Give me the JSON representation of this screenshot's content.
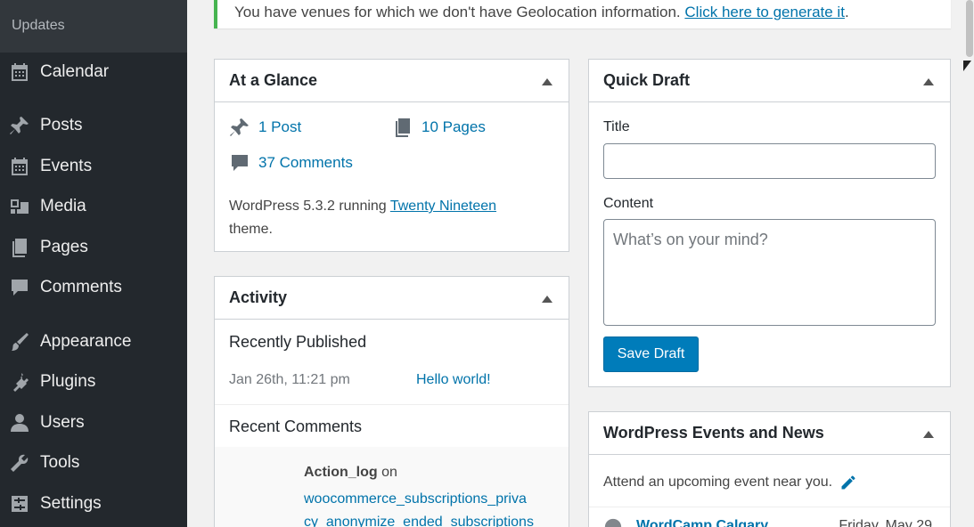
{
  "sidebar": {
    "submenu_label": "Updates",
    "items": [
      {
        "label": "Calendar",
        "icon": "calendar-icon"
      },
      {
        "label": "Posts",
        "icon": "pin-icon"
      },
      {
        "label": "Events",
        "icon": "calendar-icon"
      },
      {
        "label": "Media",
        "icon": "media-icon"
      },
      {
        "label": "Pages",
        "icon": "pages-icon"
      },
      {
        "label": "Comments",
        "icon": "comment-icon"
      },
      {
        "label": "Appearance",
        "icon": "brush-icon"
      },
      {
        "label": "Plugins",
        "icon": "plug-icon"
      },
      {
        "label": "Users",
        "icon": "user-icon"
      },
      {
        "label": "Tools",
        "icon": "wrench-icon"
      },
      {
        "label": "Settings",
        "icon": "settings-icon"
      }
    ]
  },
  "notice": {
    "text": "You have venues for which we don't have Geolocation information. ",
    "link": "Click here to generate it",
    "suffix": "."
  },
  "glance": {
    "title": "At a Glance",
    "posts": "1 Post",
    "pages": "10 Pages",
    "comments": "37 Comments",
    "version_text": "WordPress 5.3.2 running ",
    "theme_link": "Twenty Nineteen",
    "theme_suffix": " theme."
  },
  "activity": {
    "title": "Activity",
    "recently_published": "Recently Published",
    "post_date": "Jan 26th, 11:21 pm",
    "post_title": "Hello world!",
    "recent_comments": "Recent Comments",
    "comment_author": "Action_log",
    "comment_on": " on",
    "comment_post_line1": "woocommerce_subscriptions_priva",
    "comment_post_line2": "cy_anonymize_ended_subscriptions"
  },
  "quick_draft": {
    "title": "Quick Draft",
    "title_label": "Title",
    "title_value": "",
    "content_label": "Content",
    "content_placeholder": "What’s on your mind?",
    "save_label": "Save Draft"
  },
  "events": {
    "title": "WordPress Events and News",
    "intro": "Attend an upcoming event near you.",
    "event_name": "WordCamp Calgary",
    "event_date": "Friday, May 29"
  },
  "colors": {
    "accent": "#0073aa",
    "sidebar_bg": "#23282d",
    "notice_border": "#46b450",
    "button": "#007cba"
  }
}
